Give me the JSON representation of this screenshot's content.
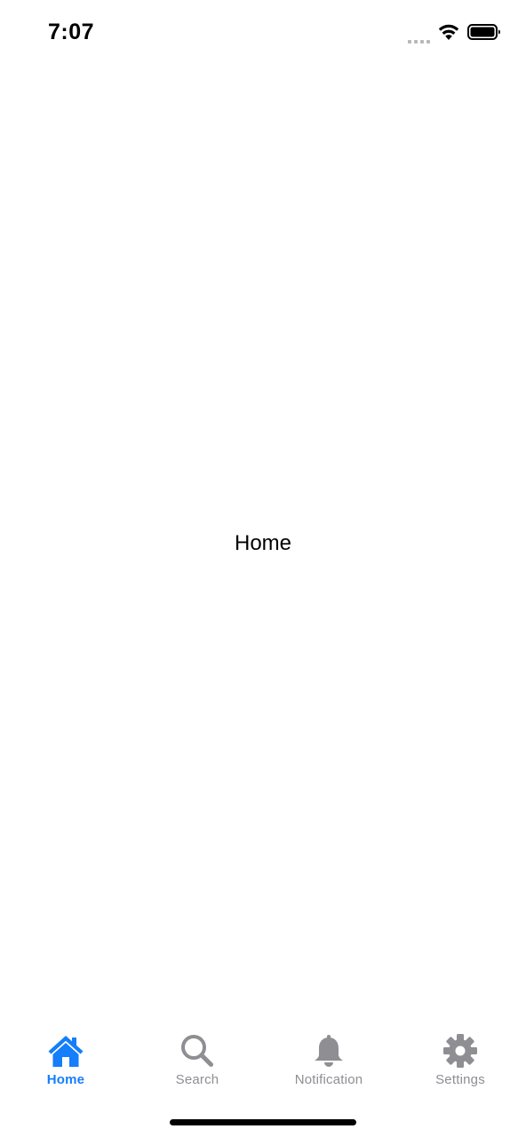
{
  "status_bar": {
    "time": "7:07"
  },
  "main": {
    "title": "Home"
  },
  "tab_bar": {
    "active_color": "#147efb",
    "inactive_color": "#8e8e93",
    "tabs": [
      {
        "label": "Home",
        "icon": "home-icon",
        "active": true
      },
      {
        "label": "Search",
        "icon": "search-icon",
        "active": false
      },
      {
        "label": "Notification",
        "icon": "bell-icon",
        "active": false
      },
      {
        "label": "Settings",
        "icon": "gear-icon",
        "active": false
      }
    ]
  }
}
